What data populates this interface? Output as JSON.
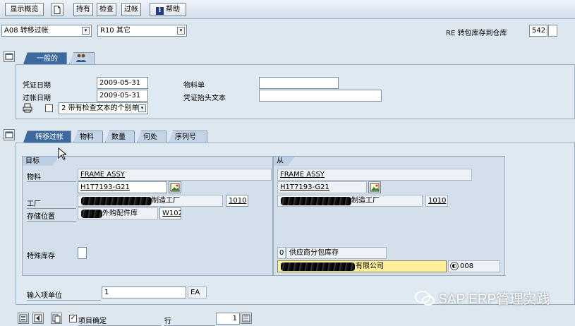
{
  "toolbar": {
    "overview": "显示概览",
    "hold": "持有",
    "check": "检查",
    "post": "过帐",
    "help": "帮助"
  },
  "header": {
    "transaction": "A08 转移过帐",
    "movement_type": "R10 其它",
    "movement_desc": "RE 转包库存到仓库",
    "movement_code": "542"
  },
  "general_tab": {
    "tab_general": "一般的",
    "doc_date_label": "凭证日期",
    "doc_date": "2009-05-31",
    "post_date_label": "过帐日期",
    "post_date": "2009-05-31",
    "material_slip_label": "物料单",
    "header_text_label": "凭证抬头文本",
    "print_option": "2 带有检查文本的个别单"
  },
  "item_tabs": [
    "转移过帐",
    "物料",
    "数量",
    "何处",
    "序列号"
  ],
  "target": {
    "title": "目标",
    "material_label": "物料",
    "material_desc": "FRAME ASSY",
    "material_no": "H1T7193-G21",
    "plant_label": "工厂",
    "plant_name": "制造工厂",
    "plant_code": "1010",
    "sloc_label": "存储位置",
    "sloc_name": "外购配件库",
    "sloc_code": "W102",
    "special_stock_label": "特殊库存"
  },
  "source": {
    "title": "从",
    "material_desc": "FRAME ASSY",
    "material_no": "H1T7193-G21",
    "plant_name": "制造工厂",
    "plant_code": "1010",
    "special_stock": "0",
    "special_stock_desc": "供应商分包库存",
    "vendor_name": "有限公司",
    "vendor_code": "008"
  },
  "quantity": {
    "label": "输入项单位",
    "value": "1",
    "unit": "EA"
  },
  "footer": {
    "item_ok_label": "项目确定",
    "row_label": "行",
    "row_value": "1"
  },
  "watermark": "SAP ERP管理实践"
}
